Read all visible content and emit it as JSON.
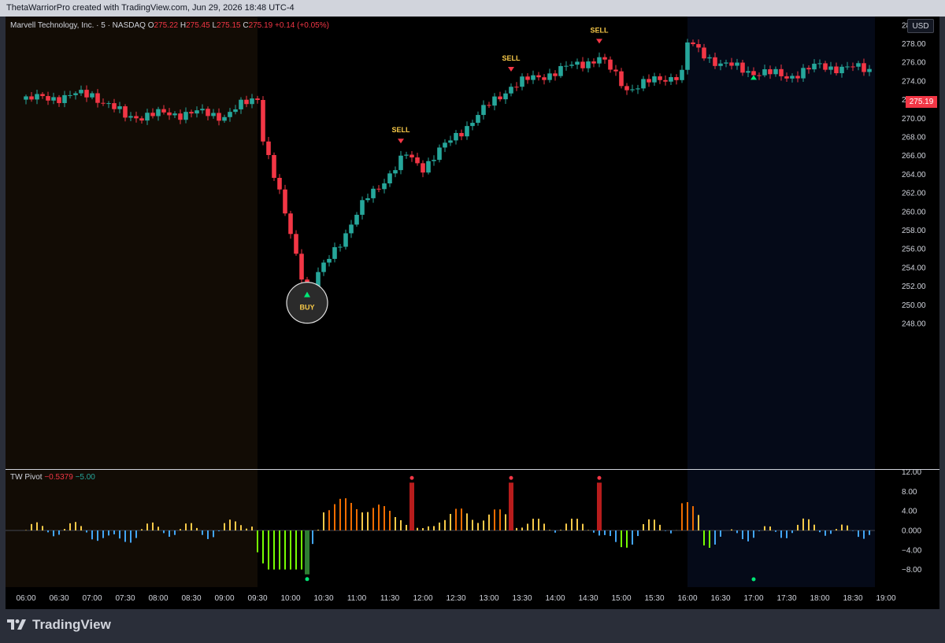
{
  "header": {
    "text": "ThetaWarriorPro created with TradingView.com, Jun 29, 2026 18:48 UTC-4"
  },
  "legend": {
    "symbol": "Marvell Technology, Inc. · 5 · NASDAQ",
    "o_label": "O",
    "o_value": "275.22",
    "h_label": "H",
    "h_value": "275.45",
    "l_label": "L",
    "l_value": "275.15",
    "c_label": "C",
    "c_value": "275.19",
    "change": "+0.14 (+0.05%)"
  },
  "currency_button": "USD",
  "last_price": "275.19",
  "price_axis": [
    "280.00",
    "278.00",
    "276.00",
    "274.00",
    "272.00",
    "270.00",
    "268.00",
    "266.00",
    "264.00",
    "262.00",
    "260.00",
    "258.00",
    "256.00",
    "254.00",
    "252.00",
    "250.00",
    "248.00"
  ],
  "indicator": {
    "name": "TW Pivot",
    "value1": "−0.5379",
    "value2": "−5.00",
    "axis": [
      "12.00",
      "8.00",
      "4.00",
      "0.000",
      "−4.00",
      "−8.00"
    ]
  },
  "time_axis": [
    "06:00",
    "06:30",
    "07:00",
    "07:30",
    "08:00",
    "08:30",
    "09:00",
    "09:30",
    "10:00",
    "10:30",
    "11:00",
    "11:30",
    "12:00",
    "12:30",
    "13:00",
    "13:30",
    "14:00",
    "14:30",
    "15:00",
    "15:30",
    "16:00",
    "16:30",
    "17:00",
    "17:30",
    "18:00",
    "18:30",
    "19:00"
  ],
  "signals": [
    {
      "label": "SELL",
      "time": "14:40",
      "price": 277.5
    },
    {
      "label": "SELL",
      "time": "13:20",
      "price": 274.5
    },
    {
      "label": "SELL",
      "time": "11:40",
      "price": 266.8
    },
    {
      "label": "BUY",
      "time": "10:15",
      "price": 250.9
    }
  ],
  "colors": {
    "up": "#26a69a",
    "down": "#f23645",
    "premarket_bg": "#120c05",
    "afterhours_bg": "#050a18",
    "label_yellow": "#f7c948"
  },
  "brand": {
    "name": "TradingView",
    "logo_icon": "tradingview-logo-icon"
  }
}
